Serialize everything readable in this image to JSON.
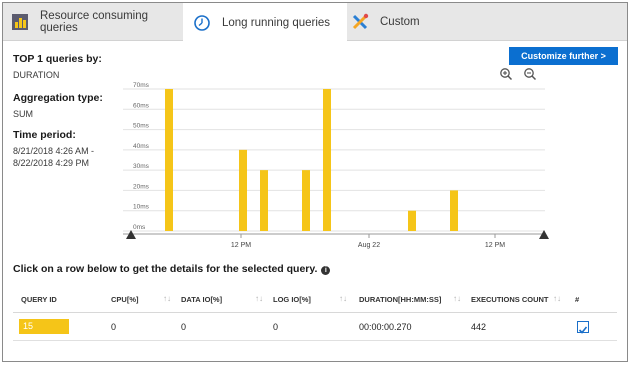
{
  "tabs": [
    {
      "label": "Resource consuming queries",
      "icon": "resource-chart-icon",
      "active": false
    },
    {
      "label": "Long running queries",
      "icon": "clock-icon",
      "active": true
    },
    {
      "label": "Custom",
      "icon": "tools-icon",
      "active": false
    }
  ],
  "info": {
    "top_label": "TOP 1 queries by:",
    "top_value": "DURATION",
    "agg_label": "Aggregation type:",
    "agg_value": "SUM",
    "period_label": "Time period:",
    "period_line1": "8/21/2018 4:26 AM -",
    "period_line2": "8/22/2018 4:29 PM"
  },
  "customize_label": "Customize further >",
  "tip": "Click on a row below to get the details for the selected query.",
  "colors": {
    "accent": "#0b6fd0",
    "bar": "#f5c518"
  },
  "chart_data": {
    "type": "bar",
    "ylim": [
      0,
      70
    ],
    "yticks": [
      "0ms",
      "10ms",
      "20ms",
      "30ms",
      "40ms",
      "50ms",
      "60ms",
      "70ms"
    ],
    "yvalues": [
      0,
      10,
      20,
      30,
      40,
      50,
      60,
      70
    ],
    "xtick_labels": [
      "12 PM",
      "Aug 22",
      "12 PM"
    ],
    "bars": [
      70,
      40,
      30,
      30,
      70,
      10,
      20
    ]
  },
  "table": {
    "headers": [
      "QUERY ID",
      "CPU[%]",
      "DATA IO[%]",
      "LOG IO[%]",
      "DURATION[HH:MM:SS]",
      "EXECUTIONS COUNT",
      "#"
    ],
    "row": {
      "query_id": "15",
      "cpu": "0",
      "data_io": "0",
      "log_io": "0",
      "duration": "00:00:00.270",
      "executions": "442",
      "checked": true
    }
  }
}
